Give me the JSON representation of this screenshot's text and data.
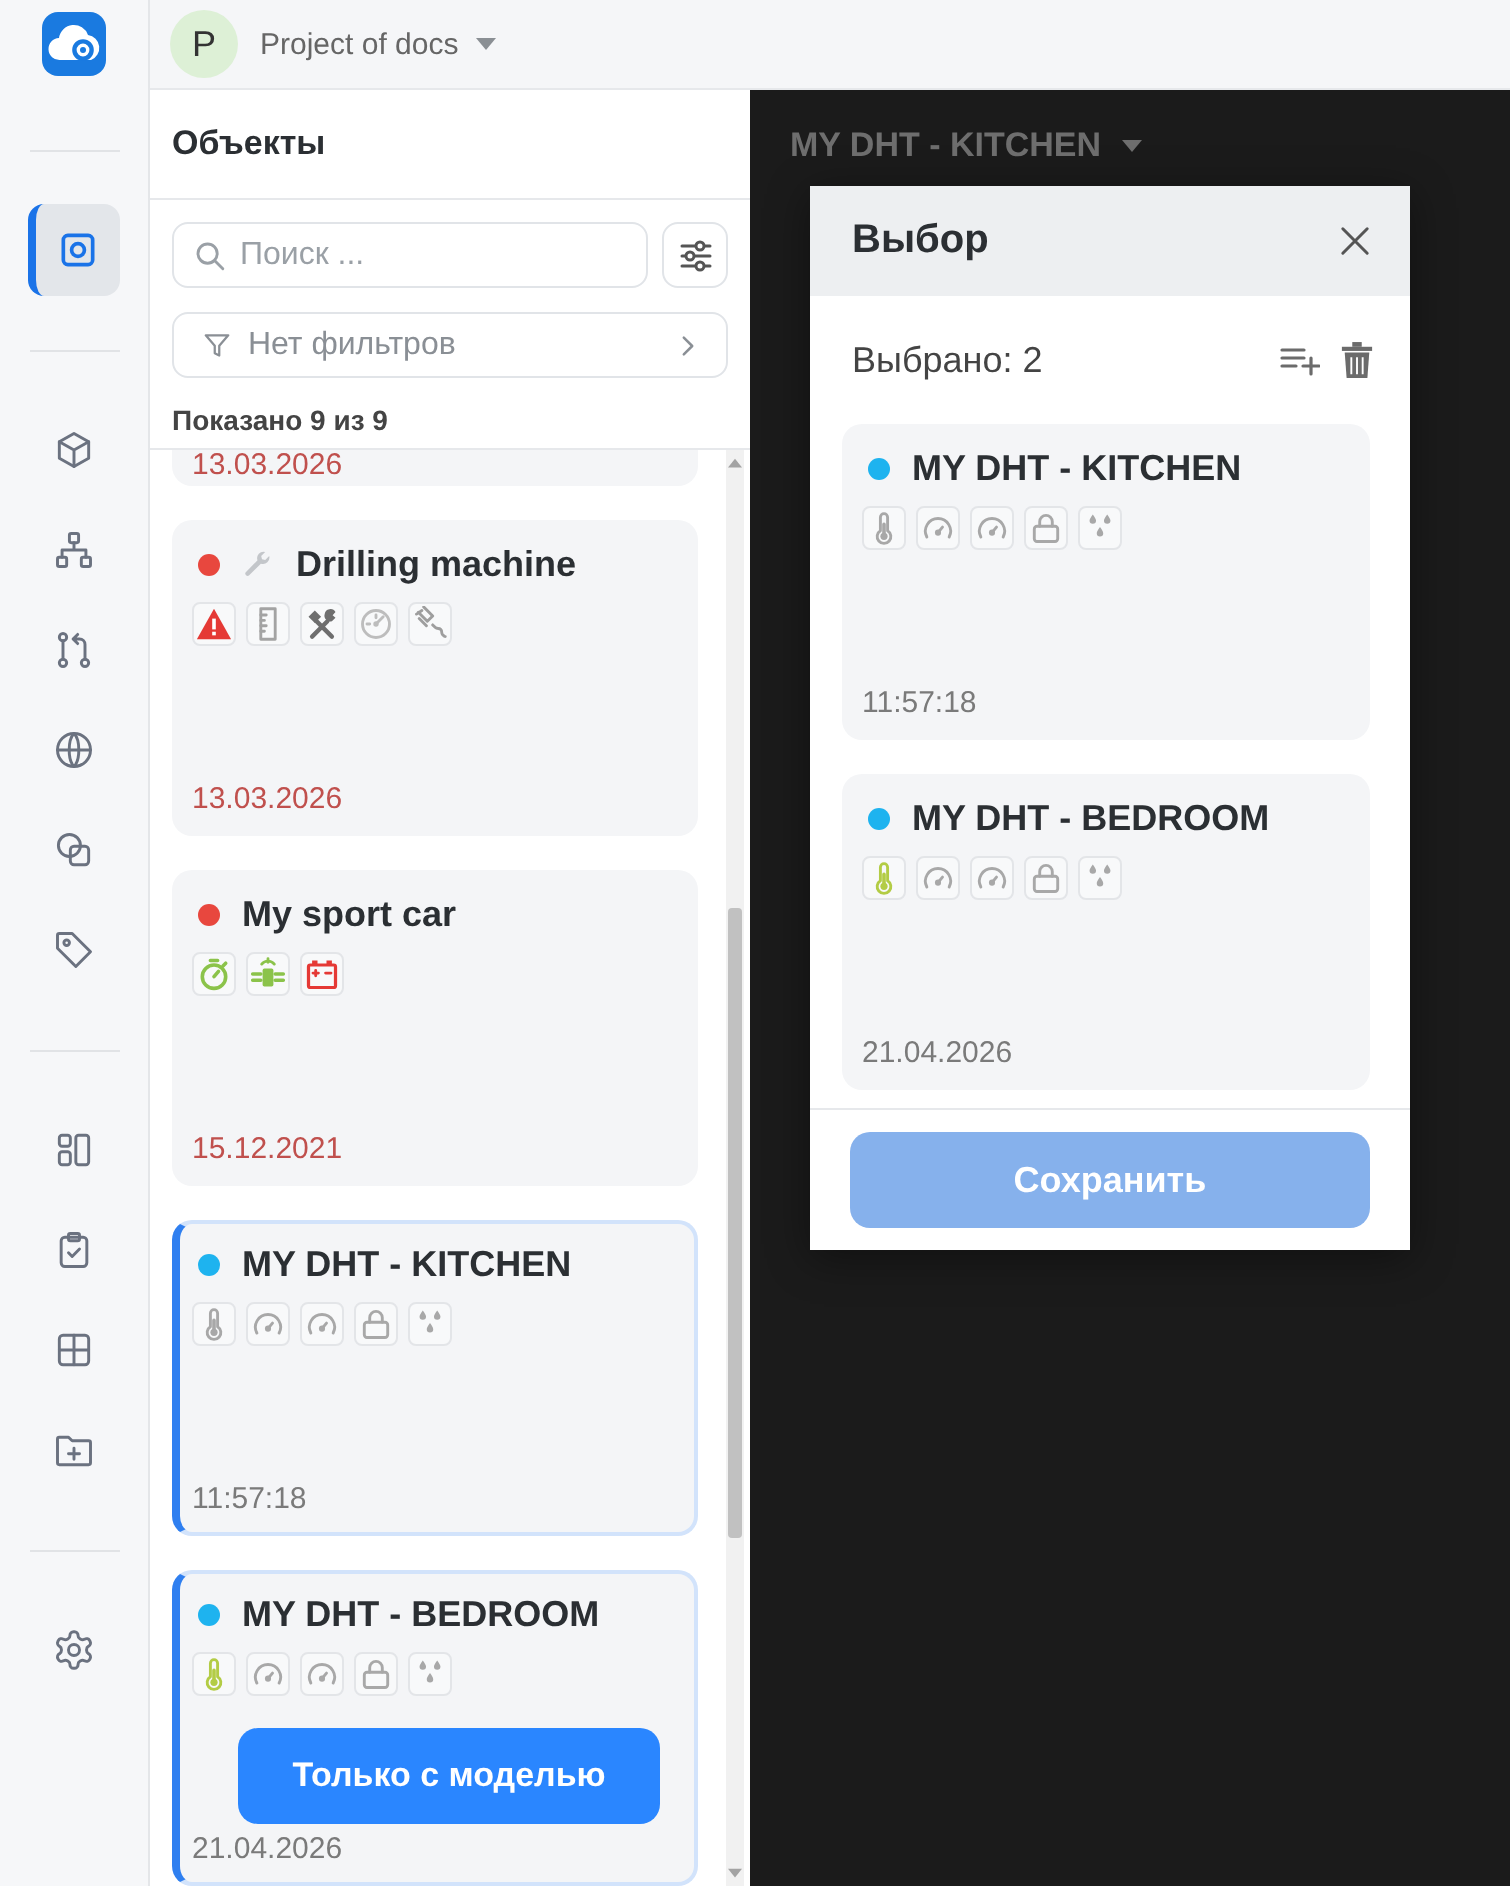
{
  "nav": {
    "groups": [
      {
        "items": [
          {
            "kind": "objects",
            "selected": true
          }
        ]
      },
      {
        "items": [
          {
            "kind": "cube",
            "selected": false
          },
          {
            "kind": "hierarchy",
            "selected": false
          },
          {
            "kind": "branches",
            "selected": false
          },
          {
            "kind": "globe",
            "selected": false
          },
          {
            "kind": "shapes",
            "selected": false
          },
          {
            "kind": "tag",
            "selected": false
          }
        ]
      },
      {
        "items": [
          {
            "kind": "layout",
            "selected": false
          },
          {
            "kind": "checklist",
            "selected": false
          },
          {
            "kind": "grid",
            "selected": false
          },
          {
            "kind": "folder_add",
            "selected": false
          }
        ]
      },
      {
        "items": [
          {
            "kind": "settings",
            "selected": false
          }
        ]
      }
    ]
  },
  "project": {
    "avatar": "P",
    "name": "Project of docs"
  },
  "objects_panel": {
    "title": "Объекты",
    "search": {
      "placeholder": "Поиск ..."
    },
    "filter": {
      "label": "Нет фильтров"
    },
    "count": "Показано 9 из 9",
    "cards": [
      {
        "kind": "cut",
        "time": "13.03.2026",
        "outdated": true,
        "selected": false
      },
      {
        "kind": "full",
        "name": "Drilling machine",
        "color": "#e8473e",
        "maintenance": true,
        "sensors": [
          {
            "kind": "warning",
            "color": "#e53935"
          },
          {
            "kind": "ruler",
            "color": "#a3a3a3"
          },
          {
            "kind": "tools",
            "color": "#6e6e6e"
          },
          {
            "kind": "gauge",
            "color": "#bdbdbd"
          },
          {
            "kind": "engine",
            "color": "#9e9e9e"
          }
        ],
        "time": "13.03.2026",
        "outdated": true,
        "selected": false
      },
      {
        "kind": "full",
        "name": "My sport car",
        "color": "#e8473e",
        "maintenance": false,
        "sensors": [
          {
            "kind": "stopwatch",
            "color": "#8bc34a"
          },
          {
            "kind": "antenna",
            "color": "#8bc34a"
          },
          {
            "kind": "battery",
            "color": "#e53935"
          }
        ],
        "time": "15.12.2021",
        "outdated": true,
        "selected": false
      },
      {
        "kind": "full",
        "name": "MY DHT - KITCHEN",
        "color": "#1eb3ef",
        "maintenance": false,
        "sensors": [
          {
            "kind": "thermometer",
            "color": "#a8a8a8"
          },
          {
            "kind": "speedometer",
            "color": "#a8a8a8"
          },
          {
            "kind": "speedometer",
            "color": "#a8a8a8"
          },
          {
            "kind": "lock",
            "color": "#a8a8a8"
          },
          {
            "kind": "drops",
            "color": "#a8a8a8"
          }
        ],
        "time": "11:57:18",
        "outdated": false,
        "selected": true
      },
      {
        "kind": "full",
        "name": "MY DHT - BEDROOM",
        "color": "#1eb3ef",
        "maintenance": false,
        "sensors": [
          {
            "kind": "thermometer",
            "color": "#b3cc45"
          },
          {
            "kind": "speedometer",
            "color": "#a8a8a8"
          },
          {
            "kind": "speedometer",
            "color": "#a8a8a8"
          },
          {
            "kind": "lock",
            "color": "#a8a8a8"
          },
          {
            "kind": "drops",
            "color": "#a8a8a8"
          }
        ],
        "time": "21.04.2026",
        "outdated": false,
        "selected": true
      }
    ],
    "model_only_button": {
      "label": "Только с моделью"
    }
  },
  "main": {
    "title": "MY DHT - KITCHEN"
  },
  "modal": {
    "title": "Выбор",
    "count": "Выбрано: 2",
    "cards": [
      {
        "kind": "full",
        "name": "MY DHT - KITCHEN",
        "color": "#1eb3ef",
        "maintenance": false,
        "sensors": [
          {
            "kind": "thermometer",
            "color": "#a8a8a8"
          },
          {
            "kind": "speedometer",
            "color": "#a8a8a8"
          },
          {
            "kind": "speedometer",
            "color": "#a8a8a8"
          },
          {
            "kind": "lock",
            "color": "#a8a8a8"
          },
          {
            "kind": "drops",
            "color": "#a8a8a8"
          }
        ],
        "time": "11:57:18",
        "outdated": false
      },
      {
        "kind": "full",
        "name": "MY DHT - BEDROOM",
        "color": "#1eb3ef",
        "maintenance": false,
        "sensors": [
          {
            "kind": "thermometer",
            "color": "#b3cc45"
          },
          {
            "kind": "speedometer",
            "color": "#a8a8a8"
          },
          {
            "kind": "speedometer",
            "color": "#a8a8a8"
          },
          {
            "kind": "lock",
            "color": "#a8a8a8"
          },
          {
            "kind": "drops",
            "color": "#a8a8a8"
          }
        ],
        "time": "21.04.2026",
        "outdated": false
      }
    ],
    "save_button": {
      "label": "Сохранить",
      "disabled": true
    }
  }
}
